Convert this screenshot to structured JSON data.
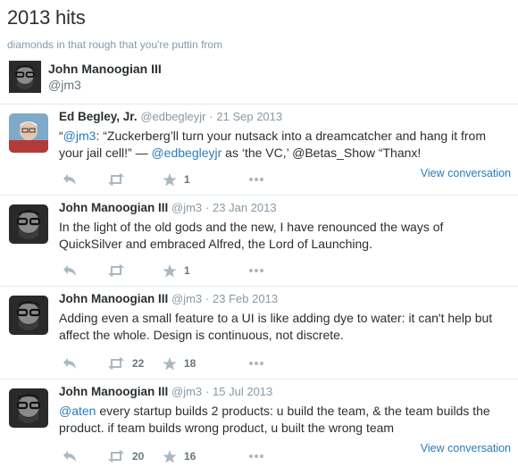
{
  "collection": {
    "title": "2013 hits",
    "description": "diamonds in that rough that you're puttin from"
  },
  "owner": {
    "name": "John Manoogian III",
    "handle": "@jm3"
  },
  "tweets": [
    {
      "author": "Ed Begley, Jr.",
      "handle": "@edbegleyjr",
      "separator": "·",
      "date": "21 Sep 2013",
      "text_parts": [
        "“",
        "@jm3",
        ": “Zuckerberg’ll turn your nutsack into a dreamcatcher and hang it from your jail cell!” — ",
        "@edbegleyjr",
        " as ‘the VC,’ @Betas_Show “Thanx!"
      ],
      "retweets": "",
      "favorites": "1",
      "view_conversation": "View conversation"
    },
    {
      "author": "John Manoogian III",
      "handle": "@jm3",
      "separator": "·",
      "date": "23 Jan 2013",
      "text": "In the light of the old gods and the new, I have renounced the ways of QuickSilver and embraced Alfred, the Lord of Launching.",
      "retweets": "",
      "favorites": "1"
    },
    {
      "author": "John Manoogian III",
      "handle": "@jm3",
      "separator": "·",
      "date": "23 Feb 2013",
      "text": "Adding even a small feature to a UI is like adding dye to water: it can't help but affect the whole. Design is continuous, not discrete.",
      "retweets": "22",
      "favorites": "18"
    },
    {
      "author": "John Manoogian III",
      "handle": "@jm3",
      "separator": "·",
      "date": "15 Jul 2013",
      "text_parts": [
        "@aten",
        " every startup builds 2 products: u build the team, & the team builds the product. if team builds wrong product, u built the wrong team"
      ],
      "retweets": "20",
      "favorites": "16",
      "view_conversation": "View conversation"
    }
  ],
  "icons": {
    "reply": "reply-icon",
    "retweet": "retweet-icon",
    "favorite": "star-icon",
    "more": "more-icon"
  },
  "colors": {
    "link": "#2b7bb9",
    "muted": "#8899a6",
    "action_icon": "#aab8c2",
    "divider": "#e1e8ed"
  }
}
